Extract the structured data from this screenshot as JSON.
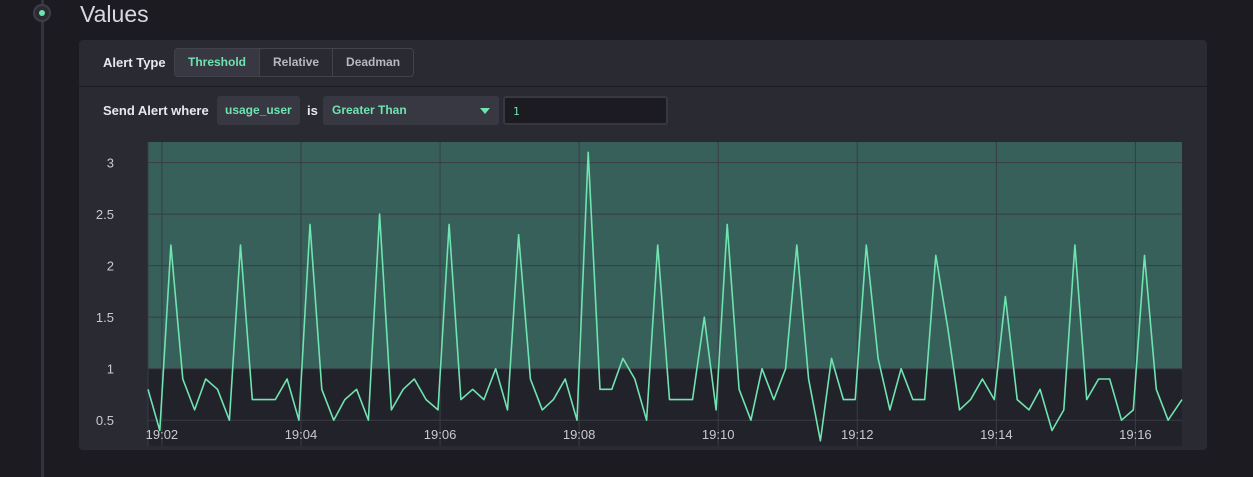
{
  "section": {
    "title": "Values"
  },
  "alert_type": {
    "label": "Alert Type",
    "options": [
      "Threshold",
      "Relative",
      "Deadman"
    ],
    "selected": "Threshold"
  },
  "condition": {
    "send_label": "Send Alert where",
    "field": "usage_user",
    "is_label": "is",
    "operator": "Greater Than",
    "value": "1"
  },
  "colors": {
    "accent": "#6fe3b0",
    "threshold_fill": "#37605a",
    "background": "#1c1b22",
    "panel": "#2a2a33"
  },
  "icons": {
    "timeline": "timeline-dot-icon",
    "dropdown": "caret-down-icon"
  },
  "chart_data": {
    "type": "line",
    "title": "",
    "xlabel": "",
    "ylabel": "",
    "x_ticks": [
      "19:02",
      "19:04",
      "19:06",
      "19:08",
      "19:10",
      "19:12",
      "19:14",
      "19:16"
    ],
    "y_ticks": [
      "0.5",
      "1",
      "1.5",
      "2",
      "2.5",
      "3"
    ],
    "x_range_minutes": [
      1.8,
      16.67
    ],
    "ylim": [
      0.25,
      3.2
    ],
    "threshold": 1,
    "threshold_region": "above",
    "grid": true,
    "series": [
      {
        "x_minutes": [
          1.8,
          1.97,
          2.13,
          2.3,
          2.47,
          2.63,
          2.8,
          2.97,
          3.13,
          3.3,
          3.47,
          3.63,
          3.8,
          3.97,
          4.13,
          4.3,
          4.47,
          4.63,
          4.8,
          4.97,
          5.13,
          5.3,
          5.47,
          5.63,
          5.8,
          5.97,
          6.13,
          6.3,
          6.47,
          6.63,
          6.8,
          6.97,
          7.13,
          7.3,
          7.47,
          7.63,
          7.8,
          7.97,
          8.13,
          8.3,
          8.47,
          8.63,
          8.8,
          8.97,
          9.13,
          9.3,
          9.47,
          9.63,
          9.8,
          9.97,
          10.13,
          10.3,
          10.47,
          10.63,
          10.8,
          10.97,
          11.13,
          11.3,
          11.47,
          11.63,
          11.8,
          11.97,
          12.13,
          12.3,
          12.47,
          12.63,
          12.8,
          12.97,
          13.13,
          13.3,
          13.47,
          13.63,
          13.8,
          13.97,
          14.13,
          14.3,
          14.47,
          14.63,
          14.8,
          14.97,
          15.13,
          15.3,
          15.47,
          15.63,
          15.8,
          15.97,
          16.13,
          16.3,
          16.47,
          16.67
        ],
        "values": [
          0.8,
          0.4,
          2.2,
          0.9,
          0.6,
          0.9,
          0.8,
          0.5,
          2.2,
          0.7,
          0.7,
          0.7,
          0.9,
          0.5,
          2.4,
          0.8,
          0.5,
          0.7,
          0.8,
          0.5,
          2.5,
          0.6,
          0.8,
          0.9,
          0.7,
          0.6,
          2.4,
          0.7,
          0.8,
          0.7,
          1.0,
          0.6,
          2.3,
          0.9,
          0.6,
          0.7,
          0.9,
          0.5,
          3.1,
          0.8,
          0.8,
          1.1,
          0.9,
          0.5,
          2.2,
          0.7,
          0.7,
          0.7,
          1.5,
          0.6,
          2.4,
          0.8,
          0.5,
          1.0,
          0.7,
          1.0,
          2.2,
          0.9,
          0.3,
          1.1,
          0.7,
          0.7,
          2.2,
          1.1,
          0.6,
          1.0,
          0.7,
          0.7,
          2.1,
          1.4,
          0.6,
          0.7,
          0.9,
          0.7,
          1.7,
          0.7,
          0.6,
          0.8,
          0.4,
          0.6,
          2.2,
          0.7,
          0.9,
          0.9,
          0.5,
          0.6,
          2.1,
          0.8,
          0.5,
          0.7
        ]
      }
    ]
  }
}
